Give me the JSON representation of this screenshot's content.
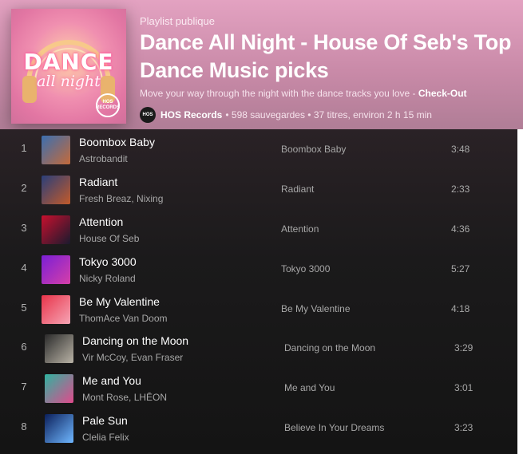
{
  "header": {
    "type_label": "Playlist publique",
    "title": "Dance All Night - House Of Seb's Top Dance Music picks",
    "description": "Move your way through the night with the dance tracks you love - ",
    "description_link": "Check-Out",
    "owner": "HOS Records",
    "meta": "• 598 sauvegardes • 37 titres, environ 2 h 15 min",
    "cover_text": "DANCE",
    "cover_subtext": "all night",
    "cover_badge": "HOS RECORDS",
    "owner_avatar_text": "HOS"
  },
  "colors": {
    "header_pink": "#e3a2c1",
    "list_bg": "#121212",
    "muted_text": "#a7a7a7"
  },
  "tracks": [
    {
      "num": "1",
      "title": "Boombox Baby",
      "artist": "Astrobandit",
      "album": "Boombox Baby",
      "duration": "3:48",
      "thumb_colors": [
        "#3b6fb1",
        "#c46a3a"
      ]
    },
    {
      "num": "2",
      "title": "Radiant",
      "artist": "Fresh Breaz, Nixing",
      "album": "Radiant",
      "duration": "2:33",
      "thumb_colors": [
        "#2a3f7a",
        "#c25a2a"
      ]
    },
    {
      "num": "3",
      "title": "Attention",
      "artist": "House Of Seb",
      "album": "Attention",
      "duration": "4:36",
      "thumb_colors": [
        "#c8102e",
        "#1a1a2e"
      ]
    },
    {
      "num": "4",
      "title": "Tokyo 3000",
      "artist": "Nicky Roland",
      "album": "Tokyo 3000",
      "duration": "5:27",
      "thumb_colors": [
        "#7a1fd6",
        "#d63fa8"
      ]
    },
    {
      "num": "5",
      "title": "Be My Valentine",
      "artist": "ThomAce Van Doom",
      "album": "Be My Valentine",
      "duration": "4:18",
      "thumb_colors": [
        "#e8344a",
        "#f6a5b5"
      ]
    },
    {
      "num": "6",
      "title": "Dancing on the Moon",
      "artist": "Vir McCoy, Evan Fraser",
      "album": "Dancing on the Moon",
      "duration": "3:29",
      "thumb_colors": [
        "#2b2b2b",
        "#b9b3a6"
      ]
    },
    {
      "num": "7",
      "title": "Me and You",
      "artist": "Mont Rose, LHĒON",
      "album": "Me and You",
      "duration": "3:01",
      "thumb_colors": [
        "#2fb3a0",
        "#e04a8c"
      ]
    },
    {
      "num": "8",
      "title": "Pale Sun",
      "artist": "Clelia Felix",
      "album": "Believe In Your Dreams",
      "duration": "3:23",
      "thumb_colors": [
        "#0b1f5a",
        "#6fb7ff"
      ]
    }
  ]
}
